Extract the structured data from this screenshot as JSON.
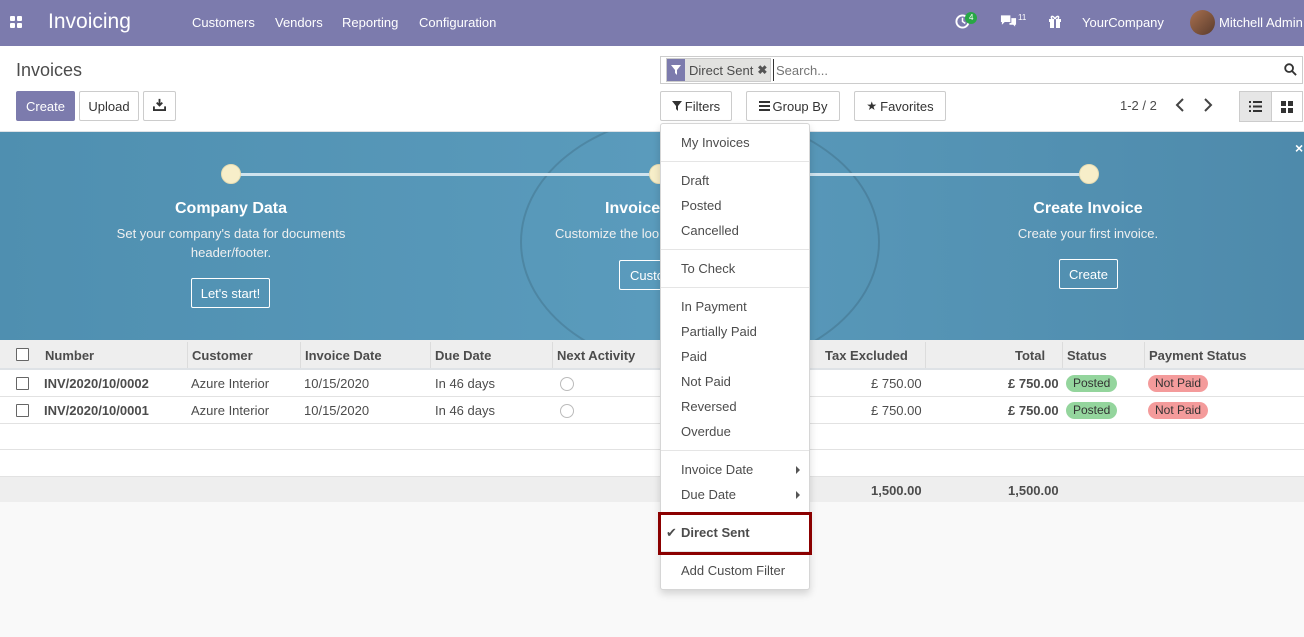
{
  "navbar": {
    "app_title": "Invoicing",
    "menu": [
      "Customers",
      "Vendors",
      "Reporting",
      "Configuration"
    ],
    "activity_badge": "4",
    "messages_badge": "11",
    "company": "YourCompany",
    "user": "Mitchell Admin",
    "accent_color": "#7c7bad"
  },
  "control_panel": {
    "breadcrumb": "Invoices",
    "create_label": "Create",
    "upload_label": "Upload",
    "download_icon": "download-icon",
    "search": {
      "facet_label": "Direct Sent",
      "placeholder": "Search..."
    },
    "filters_label": "Filters",
    "groupby_label": "Group By",
    "favorites_label": "Favorites",
    "pager": "1-2 / 2"
  },
  "banner": {
    "steps": [
      {
        "title": "Company Data",
        "description": "Set your company's data for documents header/footer.",
        "button": "Let's start!"
      },
      {
        "title": "Invoice",
        "description": "Customize the loo",
        "button": "Custo"
      },
      {
        "title": "Create Invoice",
        "description": "Create your first invoice.",
        "button": "Create"
      }
    ],
    "close": "×"
  },
  "table": {
    "headers": [
      "Number",
      "Customer",
      "Invoice Date",
      "Due Date",
      "Next Activity",
      "Tax Excluded",
      "Total",
      "Status",
      "Payment Status"
    ],
    "rows": [
      {
        "number": "INV/2020/10/0002",
        "customer": "Azure Interior",
        "invoice_date": "10/15/2020",
        "due_date": "In 46 days",
        "tax_excluded": "£ 750.00",
        "total": "£ 750.00",
        "status": "Posted",
        "payment_status": "Not Paid"
      },
      {
        "number": "INV/2020/10/0001",
        "customer": "Azure Interior",
        "invoice_date": "10/15/2020",
        "due_date": "In 46 days",
        "tax_excluded": "£ 750.00",
        "total": "£ 750.00",
        "status": "Posted",
        "payment_status": "Not Paid"
      }
    ],
    "footer": {
      "tax_excluded": "1,500.00",
      "total": "1,500.00"
    }
  },
  "filters_dropdown": {
    "items": [
      "My Invoices",
      "Draft",
      "Posted",
      "Cancelled",
      "To Check",
      "In Payment",
      "Partially Paid",
      "Paid",
      "Not Paid",
      "Reversed",
      "Overdue",
      "Invoice Date",
      "Due Date",
      "Direct Sent",
      "Add Custom Filter"
    ]
  }
}
